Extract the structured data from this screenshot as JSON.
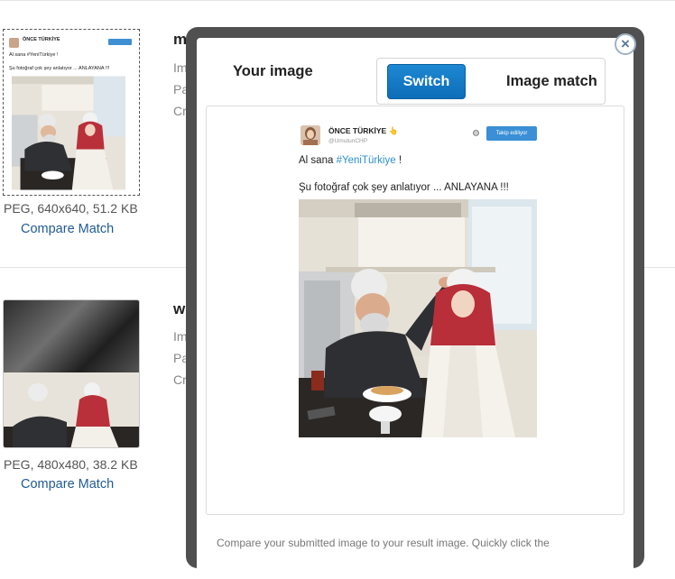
{
  "results": [
    {
      "title_visible": "m",
      "lines_visible": [
        "Im",
        "Pa",
        "Cr"
      ],
      "meta": "PEG, 640x640, 51.2 KB",
      "compare_label": "Compare Match"
    },
    {
      "title_visible": "w",
      "lines_visible": [
        "Im",
        "Pa",
        "Cr"
      ],
      "meta": "PEG, 480x480, 38.2 KB",
      "compare_label": "Compare Match"
    }
  ],
  "thumb_tweet": {
    "name": "ÖNCE TÜRKİYE",
    "line1": "Al sana #YeniTürkiye !",
    "line2": "Şu fotoğraf çok şey anlatıyor ... ANLAYANA !!!"
  },
  "modal": {
    "your_image_label": "Your image",
    "switch_label": "Switch",
    "image_match_label": "Image match",
    "close_label": "×",
    "footer_text": "Compare your submitted image to your result image. Quickly click the"
  },
  "tweet": {
    "name": "ÖNCE TÜRKİYE",
    "name_badge": "👆",
    "handle": "@UmutunCHP",
    "follow_label": "Takip ediliyor",
    "gear_icon": "gear-icon",
    "line1_pre": "Al sana ",
    "line1_hashtag": "#YeniTürkiye",
    "line1_post": " !",
    "line2": "Şu fotoğraf çok şey anlatıyor ... ANLAYANA !!!"
  },
  "colors": {
    "accent": "#0d6db8",
    "link": "#1f5a94",
    "hashtag": "#2c8fc9",
    "modal_frame": "#505050"
  }
}
